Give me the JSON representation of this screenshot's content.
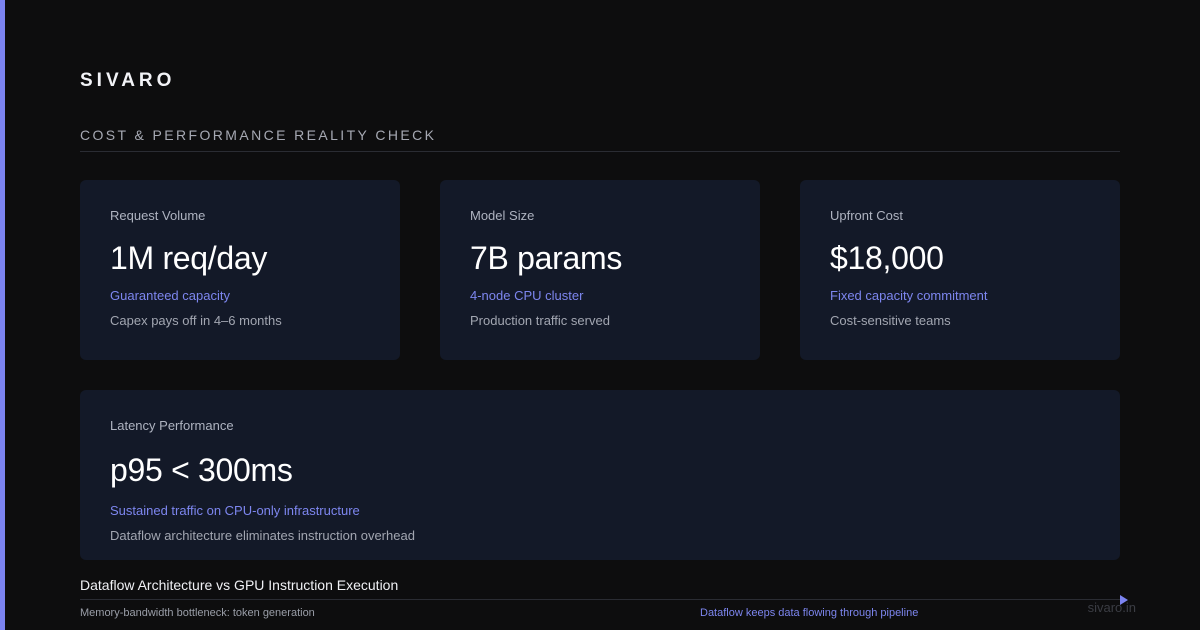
{
  "brand": "SIVARO",
  "section_title": "COST & PERFORMANCE REALITY CHECK",
  "cards": [
    {
      "label": "Request Volume",
      "value": "1M req/day",
      "accent": "Guaranteed capacity",
      "note": "Capex pays off in 4–6 months"
    },
    {
      "label": "Model Size",
      "value": "7B params",
      "accent": "4-node CPU cluster",
      "note": "Production traffic served"
    },
    {
      "label": "Upfront Cost",
      "value": "$18,000",
      "accent": "Fixed capacity commitment",
      "note": "Cost-sensitive teams"
    },
    {
      "label": "Latency Performance",
      "value": "p95 < 300ms",
      "accent": "Sustained traffic on CPU-only infrastructure",
      "note": "Dataflow architecture eliminates instruction overhead"
    }
  ],
  "comparison": {
    "title": "Dataflow Architecture vs GPU Instruction Execution",
    "left_caption": "Memory-bandwidth bottleneck: token generation",
    "right_caption": "Dataflow keeps data flowing through pipeline",
    "arrow_icon": "arrow-right-icon"
  },
  "footer_domain": "sivaro.in",
  "colors": {
    "accent": "#7b83f0",
    "background": "#0d0d0e",
    "card": "#131928"
  }
}
